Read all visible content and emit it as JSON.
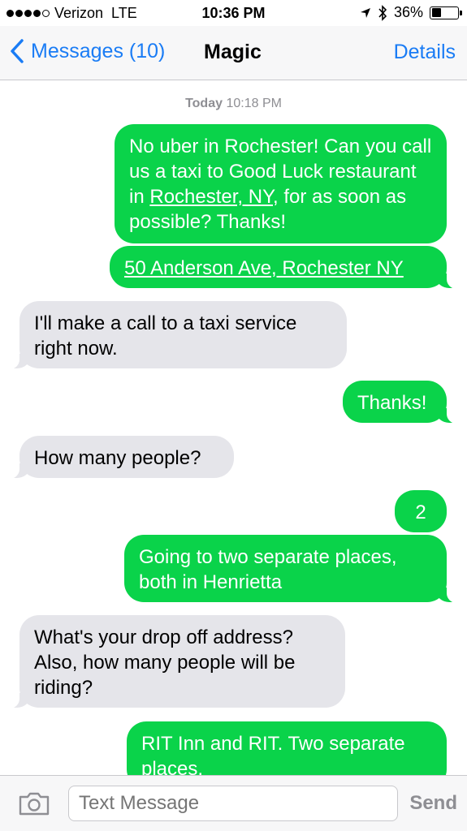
{
  "status_bar": {
    "carrier": "Verizon",
    "network": "LTE",
    "time": "10:36 PM",
    "battery": "36%",
    "battery_level": 0.36
  },
  "nav": {
    "back_label": "Messages (10)",
    "title": "Magic",
    "details_label": "Details"
  },
  "thread": {
    "timestamp_day": "Today",
    "timestamp_time": "10:18 PM",
    "messages": [
      {
        "dir": "out",
        "text_a": "No uber in Rochester! Can you call us a taxi to Good Luck restaurant in ",
        "link": "Rochester, NY",
        "text_b": ", for as soon as possible? Thanks!"
      },
      {
        "dir": "out",
        "link": "50 Anderson Ave, Rochester NY"
      },
      {
        "dir": "in",
        "text": "I'll make a call to a taxi service right now."
      },
      {
        "dir": "out",
        "text": "Thanks!"
      },
      {
        "dir": "in",
        "text": "How many people?"
      },
      {
        "dir": "out",
        "text": "2"
      },
      {
        "dir": "out",
        "text": "Going to two separate places, both in Henrietta"
      },
      {
        "dir": "in",
        "text": "What's your drop off address? Also, how many people will be riding?"
      },
      {
        "dir": "out",
        "text": "RIT Inn and RIT. Two separate places."
      }
    ]
  },
  "composer": {
    "placeholder": "Text Message",
    "send_label": "Send"
  }
}
